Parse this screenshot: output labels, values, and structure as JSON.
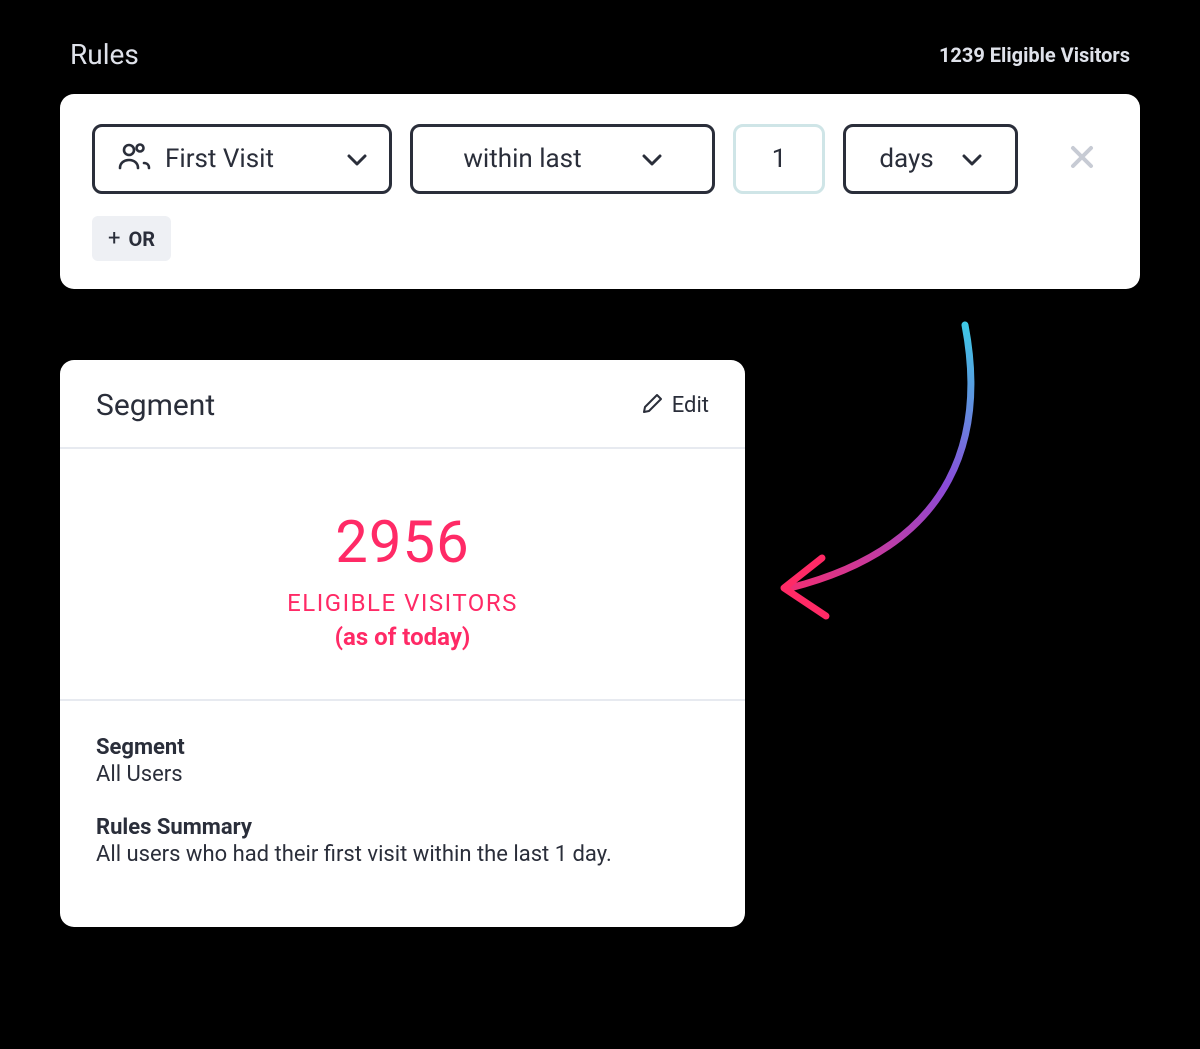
{
  "header": {
    "title": "Rules",
    "eligible_count": "1239 Eligible Visitors"
  },
  "rule": {
    "visitor_type": "First Visit",
    "time_operator": "within last",
    "time_value": "1",
    "time_unit": "days",
    "add_or_label": "OR"
  },
  "segment_card": {
    "title": "Segment",
    "edit_label": "Edit",
    "metric_value": "2956",
    "metric_label": "ELIGIBLE VISITORS",
    "metric_sub": "(as of today)",
    "segment_label": "Segment",
    "segment_value": "All Users",
    "rules_summary_label": "Rules Summary",
    "rules_summary_value": "All users who had their first visit within the last 1 day."
  }
}
